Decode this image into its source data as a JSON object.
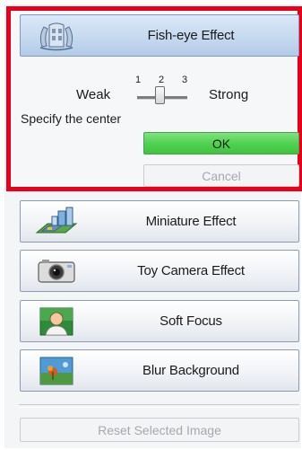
{
  "effects": {
    "fisheye": {
      "label": "Fish-eye Effect",
      "icon": "fish-eye-icon",
      "selected": true
    },
    "miniature": {
      "label": "Miniature Effect",
      "icon": "miniature-city-icon"
    },
    "toycamera": {
      "label": "Toy Camera Effect",
      "icon": "toy-camera-icon"
    },
    "softfocus": {
      "label": "Soft Focus",
      "icon": "portrait-icon"
    },
    "blurbg": {
      "label": "Blur Background",
      "icon": "landscape-icon"
    }
  },
  "fisheye_settings": {
    "weak_label": "Weak",
    "strong_label": "Strong",
    "ticks": [
      "1",
      "2",
      "3"
    ],
    "slider_value": 2,
    "specify_center": "Specify the center",
    "ok_label": "OK",
    "cancel_label": "Cancel"
  },
  "reset_label": "Reset Selected Image",
  "colors": {
    "highlight_border": "#e8001a",
    "ok_green": "#52d152",
    "active_button": "#c6d9ef"
  }
}
